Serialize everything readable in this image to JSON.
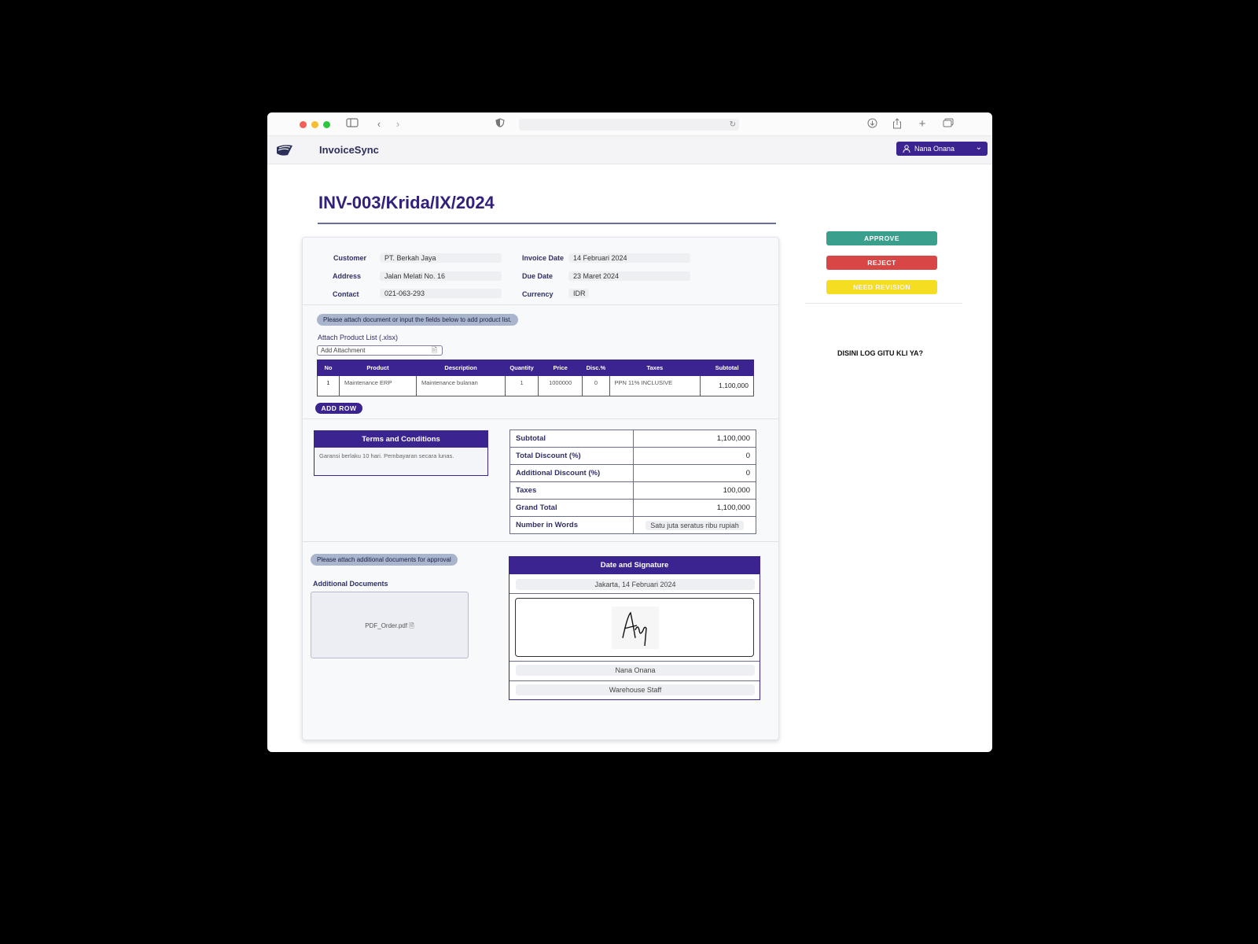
{
  "app": {
    "brand": "InvoiceSync",
    "user": "Nana Onana"
  },
  "invoice": {
    "title": "INV-003/Krida/IX/2024",
    "customer_label": "Customer",
    "customer": "PT. Berkah Jaya",
    "address_label": "Address",
    "address": "Jalan Melati No. 16",
    "contact_label": "Contact",
    "contact": "021-063-293",
    "invoice_date_label": "Invoice Date",
    "invoice_date": "14 Februari 2024",
    "due_date_label": "Due Date",
    "due_date": "23 Maret 2024",
    "currency_label": "Currency",
    "currency": "IDR"
  },
  "products": {
    "notice": "Please attach document or input the fields below to add product list.",
    "attach_label": "Attach Product List (.xlsx)",
    "attach_placeholder": "Add Attachment",
    "columns": [
      "No",
      "Product",
      "Description",
      "Quantity",
      "Price",
      "Disc.%",
      "Taxes",
      "Subtotal"
    ],
    "rows": [
      {
        "no": "1",
        "product": "Maintenance ERP",
        "description": "Maintenance bulanan",
        "quantity": "1",
        "price": "1000000",
        "disc": "0",
        "taxes": "PPN 11% INCLUSIVE",
        "subtotal": "1,100,000"
      }
    ],
    "add_row": "ADD ROW"
  },
  "terms": {
    "title": "Terms and Conditions",
    "text": "Garansi berlaku 10 hari. Pembayaran secara lunas."
  },
  "summary": {
    "subtotal_label": "Subtotal",
    "subtotal": "1,100,000",
    "total_discount_label": "Total Discount (%)",
    "total_discount": "0",
    "additional_discount_label": "Additional Discount (%)",
    "additional_discount": "0",
    "taxes_label": "Taxes",
    "taxes": "100,000",
    "grand_total_label": "Grand Total",
    "grand_total": "1,100,000",
    "words_label": "Number in Words",
    "words": "Satu juta seratus ribu rupiah"
  },
  "documents": {
    "notice": "Please attach additional documents for approval",
    "label": "Additional Documents",
    "file": "PDF_Order.pdf"
  },
  "signature": {
    "title": "Date and Signature",
    "place_date": "Jakarta, 14 Februari 2024",
    "name": "Nana Onana",
    "position": "Warehouse Staff"
  },
  "actions": {
    "approve": "APPROVE",
    "reject": "REJECT",
    "revision": "NEED REVISION"
  },
  "log_note": "DISINI LOG GITU KLI YA?",
  "colors": {
    "primary": "#3b2390",
    "approve": "#3a9f8c",
    "reject": "#d94646",
    "revision": "#f5dd22"
  }
}
